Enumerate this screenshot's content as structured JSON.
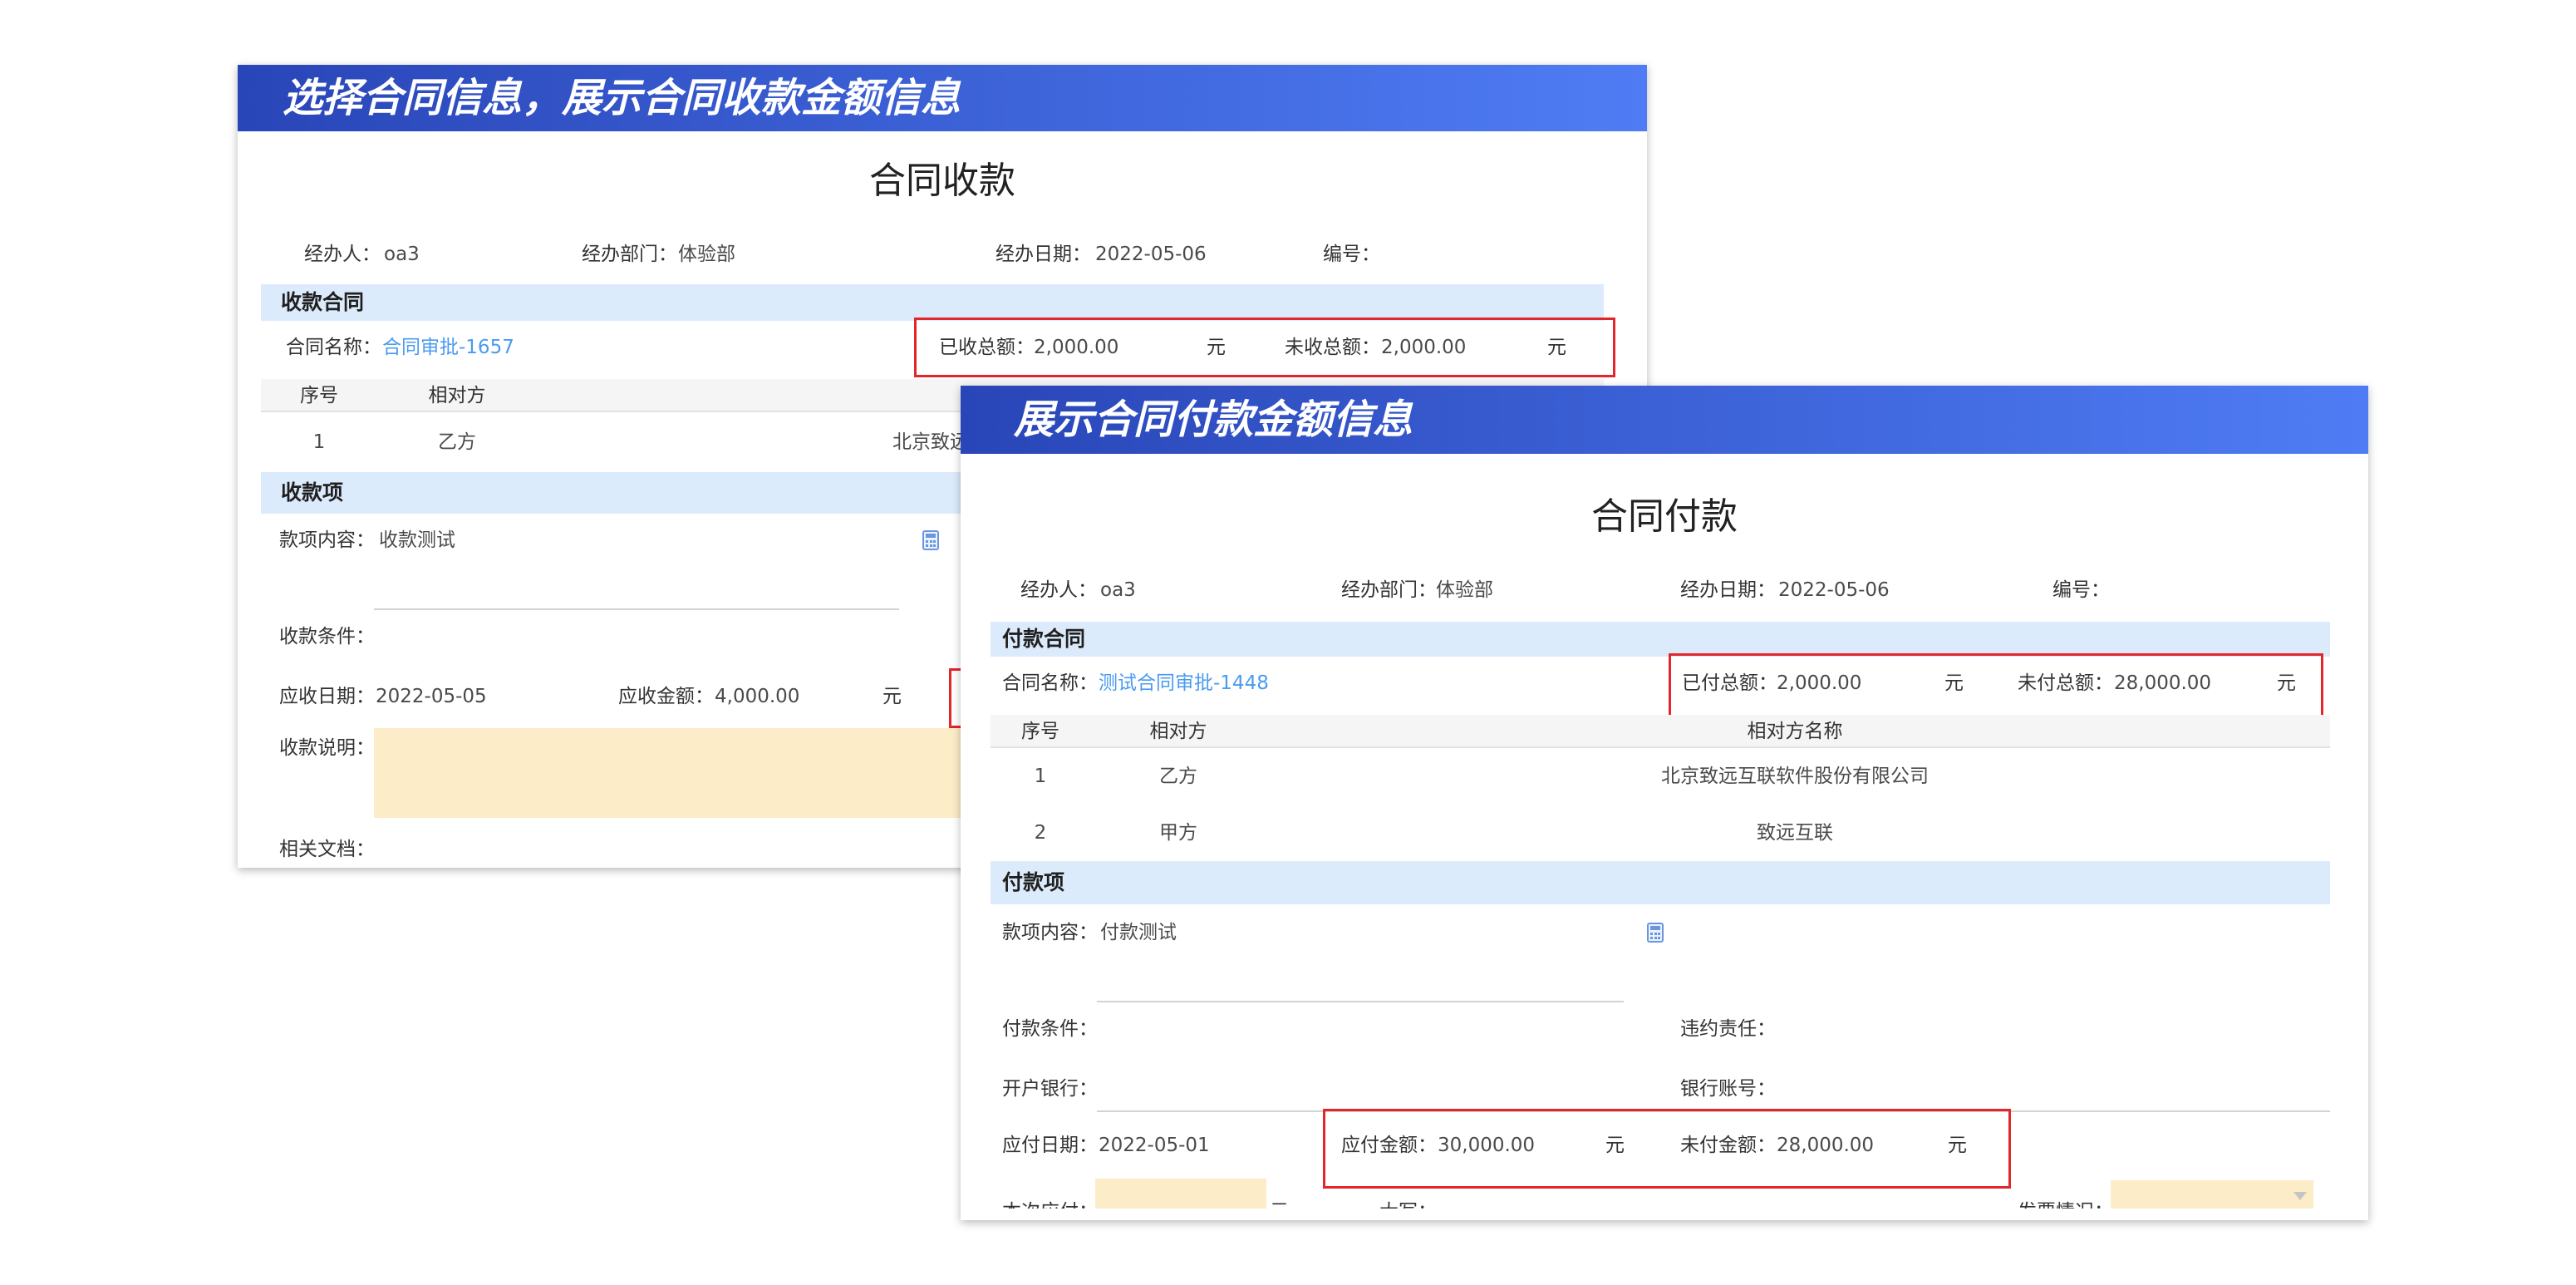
{
  "colors": {
    "banner_start": "#2946b8",
    "banner_end": "#4f7cf4",
    "section_bg": "#dcebfc",
    "table_header_bg": "#f5f5f5",
    "link": "#4a9bf0",
    "highlight_border": "#e3262b",
    "input_fill": "#fdecc8"
  },
  "icons": {
    "field_picker": "calculator-icon",
    "select_arrow": "chevron-down-icon"
  },
  "receipt": {
    "banner": "选择合同信息，展示合同收款金额信息",
    "title": "合同收款",
    "meta": {
      "handler_label": "经办人：",
      "handler": "oa3",
      "dept_label": "经办部门：",
      "dept": "体验部",
      "date_label": "经办日期：",
      "date": "2022-05-06",
      "number_label": "编号："
    },
    "contract_section": "收款合同",
    "contract_name_label": "合同名称：",
    "contract_name": "合同审批-1657",
    "totals": {
      "done_label": "已收总额：",
      "done_value": "2,000.00",
      "done_unit": "元",
      "pending_label": "未收总额：",
      "pending_value": "2,000.00",
      "pending_unit": "元"
    },
    "table": {
      "headers": {
        "index": "序号",
        "party": "相对方"
      },
      "rows": [
        {
          "index": "1",
          "party": "乙方",
          "name": "北京致远"
        }
      ]
    },
    "item_section": "收款项",
    "item": {
      "content_label": "款项内容：",
      "content": "收款测试",
      "condition_label": "收款条件：",
      "due_date_label": "应收日期：",
      "due_date": "2022-05-05",
      "amount_label": "应收金额：",
      "amount": "4,000.00",
      "amount_unit": "元",
      "note_label": "收款说明：",
      "docs_label": "相关文档："
    }
  },
  "payment": {
    "banner": "展示合同付款金额信息",
    "title": "合同付款",
    "meta": {
      "handler_label": "经办人：",
      "handler": "oa3",
      "dept_label": "经办部门：",
      "dept": "体验部",
      "date_label": "经办日期：",
      "date": "2022-05-06",
      "number_label": "编号："
    },
    "contract_section": "付款合同",
    "contract_name_label": "合同名称：",
    "contract_name": "测试合同审批-1448",
    "totals": {
      "done_label": "已付总额：",
      "done_value": "2,000.00",
      "done_unit": "元",
      "pending_label": "未付总额：",
      "pending_value": "28,000.00",
      "pending_unit": "元"
    },
    "table": {
      "headers": {
        "index": "序号",
        "party": "相对方",
        "name": "相对方名称"
      },
      "rows": [
        {
          "index": "1",
          "party": "乙方",
          "name": "北京致远互联软件股份有限公司"
        },
        {
          "index": "2",
          "party": "甲方",
          "name": "致远互联"
        }
      ]
    },
    "item_section": "付款项",
    "item": {
      "content_label": "款项内容：",
      "content": "付款测试",
      "condition_label": "付款条件：",
      "breach_label": "违约责任：",
      "bank_label": "开户银行：",
      "account_label": "银行账号：",
      "due_date_label": "应付日期：",
      "due_date": "2022-05-01",
      "amount_label": "应付金额：",
      "amount": "30,000.00",
      "amount_unit": "元",
      "unpaid_label": "未付金额：",
      "unpaid": "28,000.00",
      "unpaid_unit": "元",
      "current_label": "本次应付：",
      "current_unit": "元",
      "uppercase_label": "大写：",
      "invoice_label": "发票情况："
    }
  }
}
